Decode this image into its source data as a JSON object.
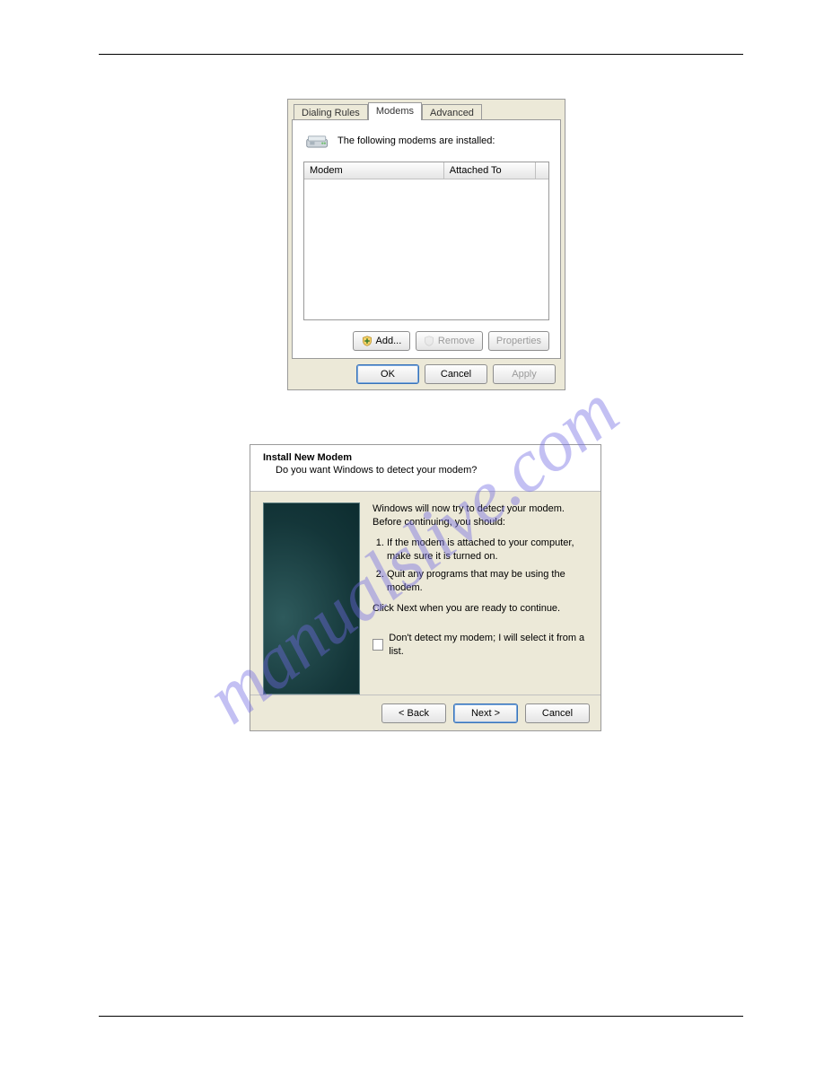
{
  "watermark": "manualslive.com",
  "dialog1": {
    "tabs": {
      "dialing": "Dialing Rules",
      "modems": "Modems",
      "advanced": "Advanced"
    },
    "infoText": "The following modems are installed:",
    "columns": {
      "modem": "Modem",
      "attached": "Attached To"
    },
    "buttons": {
      "add": "Add...",
      "remove": "Remove",
      "properties": "Properties"
    },
    "bottom": {
      "ok": "OK",
      "cancel": "Cancel",
      "apply": "Apply"
    }
  },
  "dialog2": {
    "title": "Install New Modem",
    "subtitle": "Do you want Windows to detect your modem?",
    "intro": "Windows will now try to detect your modem.  Before continuing, you should:",
    "step1": "If the modem is attached to your computer, make sure it is turned on.",
    "step2": "Quit any programs that may be using the modem.",
    "continueText": "Click Next when you are ready to continue.",
    "checkboxLabel": "Don't detect my modem; I will select it from a list.",
    "buttons": {
      "back": "< Back",
      "next": "Next >",
      "cancel": "Cancel"
    }
  }
}
